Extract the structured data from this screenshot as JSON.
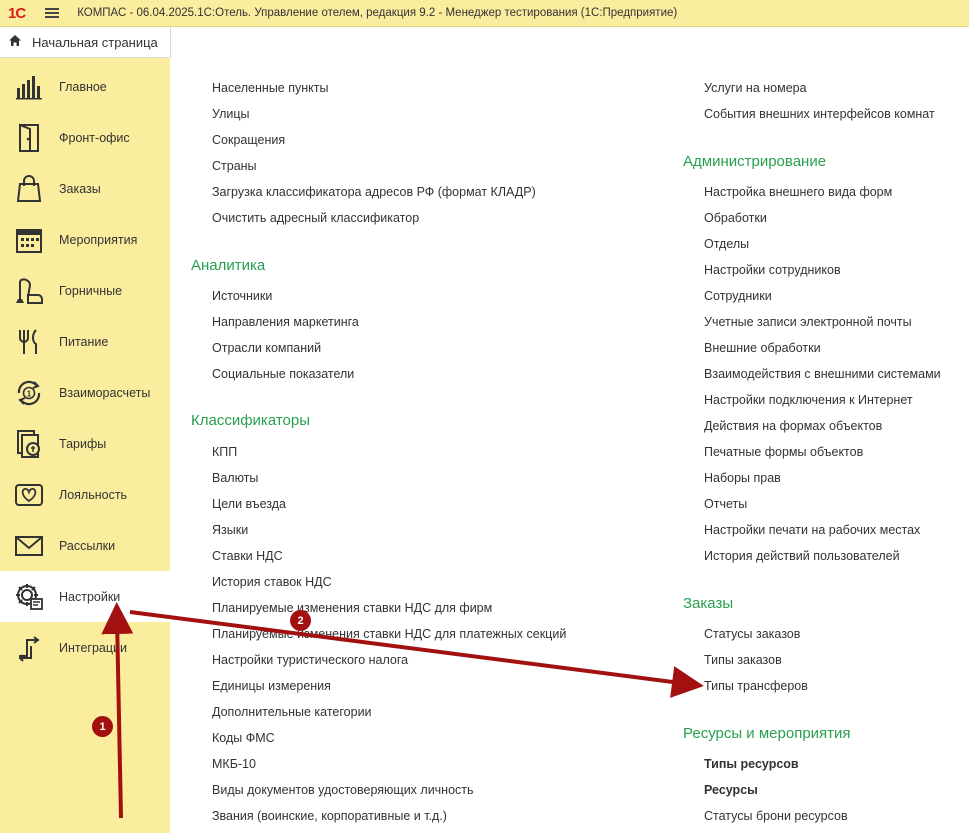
{
  "titlebar": {
    "logo": "1С",
    "title": "КОМПАС - 06.04.2025.1С:Отель. Управление отелем, редакция 9.2  - Менеджер тестирования (1С:Предприятие)"
  },
  "home": {
    "label": "Начальная страница"
  },
  "sidebar": {
    "items": [
      {
        "label": "Главное",
        "icon": "bar-chart-icon"
      },
      {
        "label": "Фронт-офис",
        "icon": "door-icon"
      },
      {
        "label": "Заказы",
        "icon": "shopping-bag-icon"
      },
      {
        "label": "Мероприятия",
        "icon": "calendar-icon"
      },
      {
        "label": "Горничные",
        "icon": "vacuum-icon"
      },
      {
        "label": "Питание",
        "icon": "fork-knife-icon"
      },
      {
        "label": "Взаиморасчеты",
        "icon": "settlement-cycle-icon"
      },
      {
        "label": "Тарифы",
        "icon": "tariff-icon"
      },
      {
        "label": "Лояльность",
        "icon": "heart-card-icon"
      },
      {
        "label": "Рассылки",
        "icon": "envelope-icon"
      },
      {
        "label": "Настройки",
        "icon": "gear-icon",
        "active": true
      },
      {
        "label": "Интеграции",
        "icon": "integration-arrows-icon"
      }
    ]
  },
  "left_column": {
    "top_links": [
      "Населенные пункты",
      "Улицы",
      "Сокращения",
      "Страны",
      "Загрузка классификатора адресов РФ (формат КЛАДР)",
      "Очистить адресный классификатор"
    ],
    "analytics": {
      "title": "Аналитика",
      "links": [
        "Источники",
        "Направления маркетинга",
        "Отрасли компаний",
        "Социальные показатели"
      ]
    },
    "classifiers": {
      "title": "Классификаторы",
      "links": [
        "КПП",
        "Валюты",
        "Цели въезда",
        "Языки",
        "Ставки НДС",
        "История ставок НДС",
        "Планируемые изменения ставки НДС для фирм",
        "Планируемые изменения ставки НДС для платежных секций",
        "Настройки туристического налога",
        "Единицы измерения",
        "Дополнительные категории",
        "Коды ФМС",
        "МКБ-10",
        "Виды документов удостоверяющих личность",
        "Звания (воинские, корпоративные и т.д.)"
      ]
    }
  },
  "right_column": {
    "top_links": [
      "Услуги на номера",
      "События внешних интерфейсов комнат"
    ],
    "administration": {
      "title": "Администрирование",
      "links": [
        "Настройка внешнего вида форм",
        "Обработки",
        "Отделы",
        "Настройки сотрудников",
        "Сотрудники",
        "Учетные записи электронной почты",
        "Внешние обработки",
        "Взаимодействия с внешними системами",
        "Настройки подключения к Интернет",
        "Действия на формах объектов",
        "Печатные формы объектов",
        "Наборы прав",
        "Отчеты",
        "Настройки печати на рабочих местах",
        "История действий пользователей"
      ]
    },
    "orders": {
      "title": "Заказы",
      "links": [
        "Статусы заказов",
        "Типы заказов",
        "Типы трансферов"
      ]
    },
    "resources": {
      "title": "Ресурсы и мероприятия",
      "links": [
        "Типы ресурсов",
        "Ресурсы",
        "Статусы брони ресурсов"
      ]
    }
  },
  "annotations": {
    "badge1": "1",
    "badge2": "2"
  },
  "colors": {
    "sidebar_bg": "#fbed9e",
    "section_title": "#28a050",
    "annotation": "#a31010"
  }
}
